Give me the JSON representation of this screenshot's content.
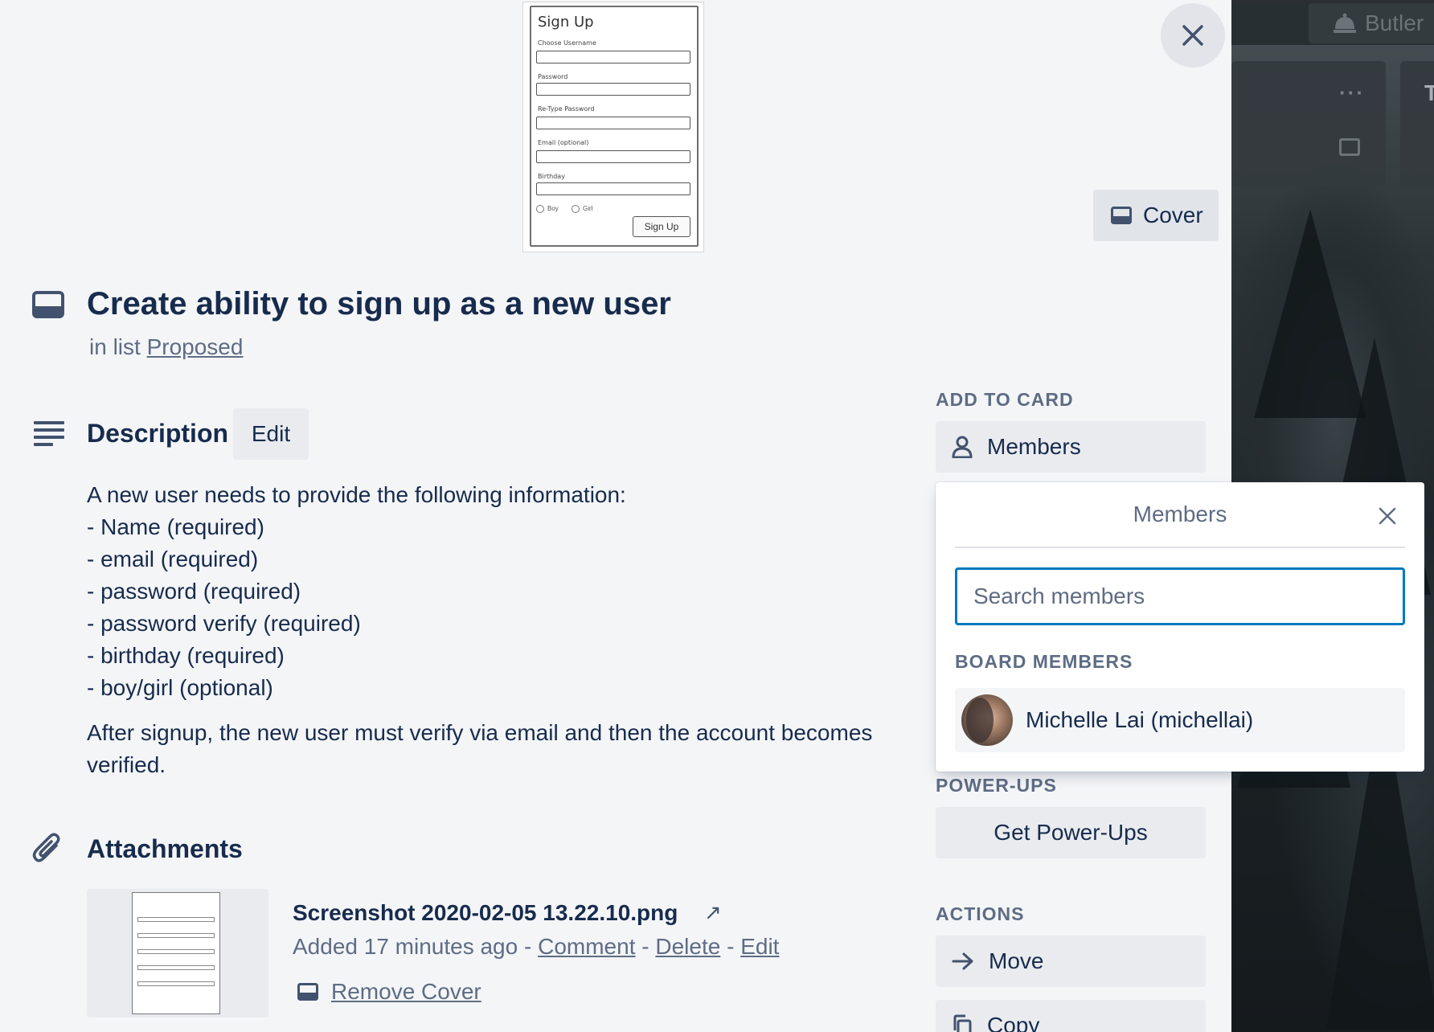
{
  "board": {
    "butler_label": "Butler",
    "list_menu": "···",
    "next_list_letter": "T"
  },
  "card": {
    "title": "Create ability to sign up as a new user",
    "in_list_prefix": "in list",
    "list_name": "Proposed",
    "cover_button_label": "Cover",
    "cover_preview": {
      "title": "Sign Up",
      "fields": [
        "Choose Username",
        "Password",
        "Re-Type Password",
        "Email (optional)",
        "Birthday"
      ],
      "radio_options": [
        "Boy",
        "Girl"
      ],
      "button": "Sign Up"
    }
  },
  "description": {
    "heading": "Description",
    "edit_label": "Edit",
    "lines": [
      "A new user needs to provide the following information:",
      "- Name (required)",
      "- email (required)",
      "- password (required)",
      "- password verify (required)",
      "- birthday (required)",
      "- boy/girl (optional)"
    ],
    "paragraph": "After signup, the new user must verify via email and then the account becomes verified."
  },
  "attachments": {
    "heading": "Attachments",
    "items": [
      {
        "name": "Screenshot 2020-02-05 13.22.10.png",
        "external_arrow": "↗",
        "added": "Added 17 minutes ago",
        "sep": " - ",
        "comment": "Comment",
        "delete": "Delete",
        "edit": "Edit",
        "remove_cover": "Remove Cover"
      }
    ]
  },
  "sidebar": {
    "add_to_card_heading": "ADD TO CARD",
    "members_label": "Members",
    "power_ups_heading": "POWER-UPS",
    "get_power_ups_label": "Get Power-Ups",
    "actions_heading": "ACTIONS",
    "move_label": "Move",
    "copy_label": "Copy"
  },
  "members_popover": {
    "title": "Members",
    "search_placeholder": "Search members",
    "board_members_heading": "BOARD MEMBERS",
    "members": [
      {
        "name": "Michelle Lai (michellai)"
      }
    ]
  },
  "colors": {
    "accent": "#0079bf",
    "text_primary": "#172b4d",
    "text_secondary": "#5e6c84",
    "button_bg": "#e9ebee",
    "modal_bg": "#f4f5f7"
  }
}
